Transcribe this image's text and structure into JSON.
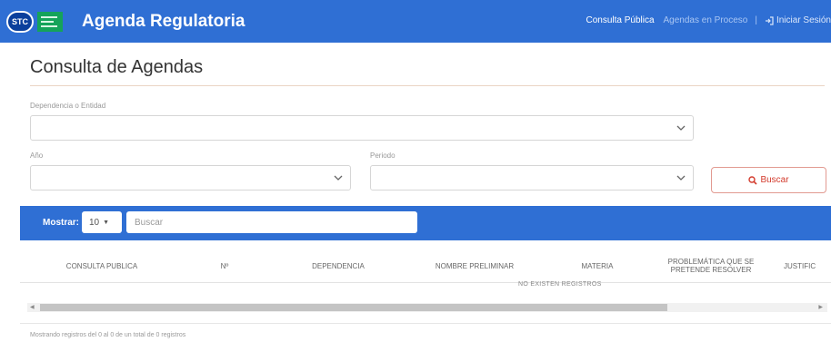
{
  "navbar": {
    "logo_text": "STC",
    "brand": "Agenda Regulatoria",
    "links": [
      "Consulta Pública",
      "Agendas en Proceso"
    ],
    "login": "Iniciar Sesión",
    "bg_color": "#2f6fd4"
  },
  "page": {
    "title": "Consulta de Agendas"
  },
  "filters": {
    "dependencia_label": "Dependencia o Entidad",
    "dependencia_value": "",
    "anio_label": "Año",
    "anio_value": "",
    "periodo_label": "Periodo",
    "periodo_value": "",
    "search_button": "Buscar"
  },
  "table": {
    "show_label": "Mostrar:",
    "page_length": "10",
    "search_placeholder": "Buscar",
    "columns": [
      "CONSULTA PUBLICA",
      "Nº",
      "DEPENDENCIA",
      "NOMBRE PRELIMINAR",
      "MATERIA",
      "PROBLEMÁTICA QUE SE PRETENDE RESOLVER",
      "JUSTIFIC"
    ],
    "empty_message": "NO EXISTEN REGISTROS",
    "info": "Mostrando registros del 0 al 0 de un total de 0 registros"
  },
  "colors": {
    "accent": "#2f6fd4",
    "danger": "#d33a2c"
  }
}
